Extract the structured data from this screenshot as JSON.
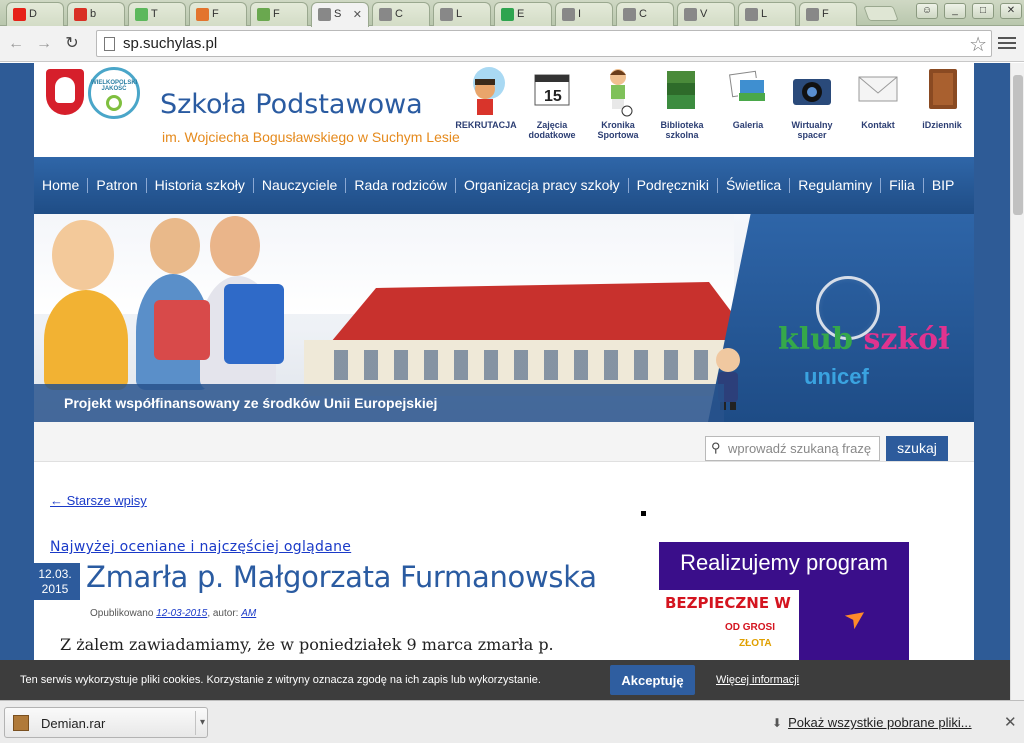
{
  "browser": {
    "tabs": [
      {
        "label": "D",
        "icon": "youtube-icon",
        "color": "#e62117",
        "active": false
      },
      {
        "label": "b",
        "icon": "gmail-icon",
        "color": "#d93025",
        "active": false
      },
      {
        "label": "T",
        "icon": "leaf-icon",
        "color": "#5cb85c",
        "active": false
      },
      {
        "label": "F",
        "icon": "g-orange-icon",
        "color": "#e3742d",
        "active": false
      },
      {
        "label": "F",
        "icon": "g-green-icon",
        "color": "#6aa84f",
        "active": false
      },
      {
        "label": "S",
        "icon": "page-icon",
        "color": "#888888",
        "active": true
      },
      {
        "label": "C",
        "icon": "page-icon",
        "color": "#888888",
        "active": false
      },
      {
        "label": "L",
        "icon": "page-icon",
        "color": "#888888",
        "active": false
      },
      {
        "label": "E",
        "icon": "p-green-icon",
        "color": "#2ea44f",
        "active": false
      },
      {
        "label": "I",
        "icon": "page-icon",
        "color": "#888888",
        "active": false
      },
      {
        "label": "C",
        "icon": "page-icon",
        "color": "#888888",
        "active": false
      },
      {
        "label": "V",
        "icon": "page-icon",
        "color": "#888888",
        "active": false
      },
      {
        "label": "L",
        "icon": "page-icon",
        "color": "#888888",
        "active": false
      },
      {
        "label": "F",
        "icon": "page-icon",
        "color": "#888888",
        "active": false
      }
    ],
    "url": "sp.suchylas.pl",
    "accent": "#2d5b9c"
  },
  "header": {
    "title": "Szkoła Podstawowa",
    "subtitle": "im. Wojciecha Bogusławskiego w Suchym Lesie",
    "badge_text": "WIELKOPOLSKI JAKOŚĆ",
    "quick_links": [
      {
        "label": "REKRUTACJA",
        "icon": "boy-science-icon"
      },
      {
        "label": "Zajęcia dodatkowe",
        "icon": "calendar-icon",
        "day": "15"
      },
      {
        "label": "Kronika Sportowa",
        "icon": "football-kid-icon"
      },
      {
        "label": "Biblioteka szkolna",
        "icon": "books-icon"
      },
      {
        "label": "Galeria",
        "icon": "photos-icon"
      },
      {
        "label": "Wirtualny spacer",
        "icon": "camera-icon"
      },
      {
        "label": "Kontakt",
        "icon": "envelope-icon"
      },
      {
        "label": "iDziennik",
        "icon": "notebook-icon"
      }
    ]
  },
  "nav": {
    "items": [
      "Home",
      "Patron",
      "Historia szkoły",
      "Nauczyciele",
      "Rada rodziców",
      "Organizacja pracy szkoły",
      "Podręczniki",
      "Świetlica",
      "Regulaminy",
      "Filia",
      "BIP"
    ]
  },
  "banner": {
    "caption": "Projekt współfinansowany ze środków Unii Europejskiej",
    "klub1": "klub",
    "klub2": "szkół",
    "unicef": "unicef"
  },
  "search": {
    "placeholder": "wprowadź szukaną frazę",
    "button": "szukaj"
  },
  "content": {
    "older_link": "← Starsze wpisy",
    "popular_link": "Najwyżej oceniane i najczęściej oglądane",
    "post": {
      "date_day": "12.03.",
      "date_year": "2015",
      "title": "Zmarła p. Małgorzata Furmanowska",
      "meta_prefix": "Opublikowano",
      "meta_date": "12-03-2015",
      "meta_author_prefix": ", autor:",
      "meta_author": "AM",
      "body": "Z żalem zawiadamiamy, że w poniedziałek 9 marca zmarła p."
    },
    "sidebar": {
      "program_title": "Realizujemy program",
      "banner1": "BEZPIECZNE W",
      "banner2": "OD GROSI",
      "banner3": "ZŁOTA"
    }
  },
  "cookie": {
    "text": "Ten serwis wykorzystuje pliki cookies. Korzystanie z witryny oznacza zgodę na ich zapis lub wykorzystanie.",
    "accept": "Akceptuję",
    "more": "Więcej informacji"
  },
  "downloads": {
    "file": "Demian.rar",
    "show_all": "Pokaż wszystkie pobrane pliki..."
  }
}
